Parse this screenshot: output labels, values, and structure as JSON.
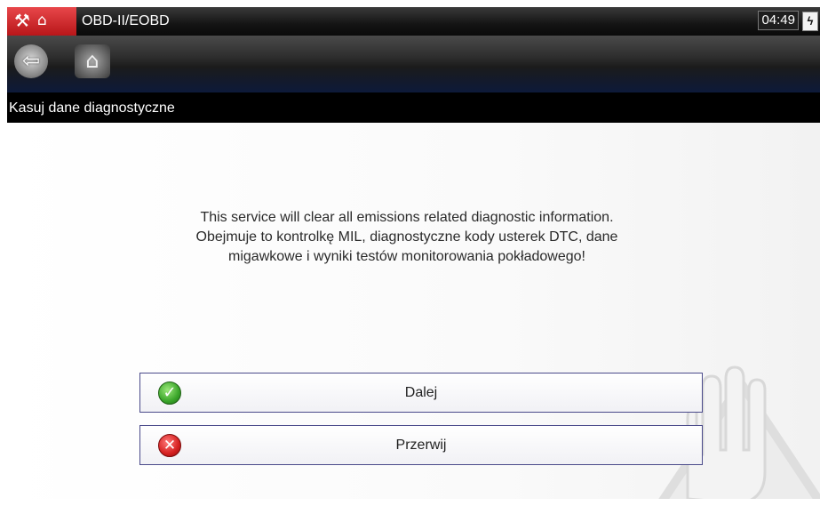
{
  "titlebar": {
    "title": "OBD-II/EOBD",
    "clock": "04:49",
    "app_icon": "scanner-app-icon",
    "battery_icon": "battery-charging-icon"
  },
  "toolbar": {
    "back_icon": "back-arrow-icon",
    "home_icon": "home-icon"
  },
  "header": {
    "title": "Kasuj dane diagnostyczne"
  },
  "message": {
    "lines": [
      "This service will clear all emissions related diagnostic information.",
      "Obejmuje to kontrolkę MIL, diagnostyczne kody usterek DTC, dane",
      "migawkowe i wyniki testów monitorowania pokładowego!"
    ]
  },
  "buttons": {
    "continue_label": "Dalej",
    "abort_label": "Przerwij",
    "continue_icon": "green-check-icon",
    "abort_icon": "red-x-icon"
  },
  "colors": {
    "header_bg": "#000000",
    "app_icon_bg": "#c8282b",
    "button_border": "#4a4a8a",
    "check_green": "#3aa52a",
    "x_red": "#d52020"
  }
}
